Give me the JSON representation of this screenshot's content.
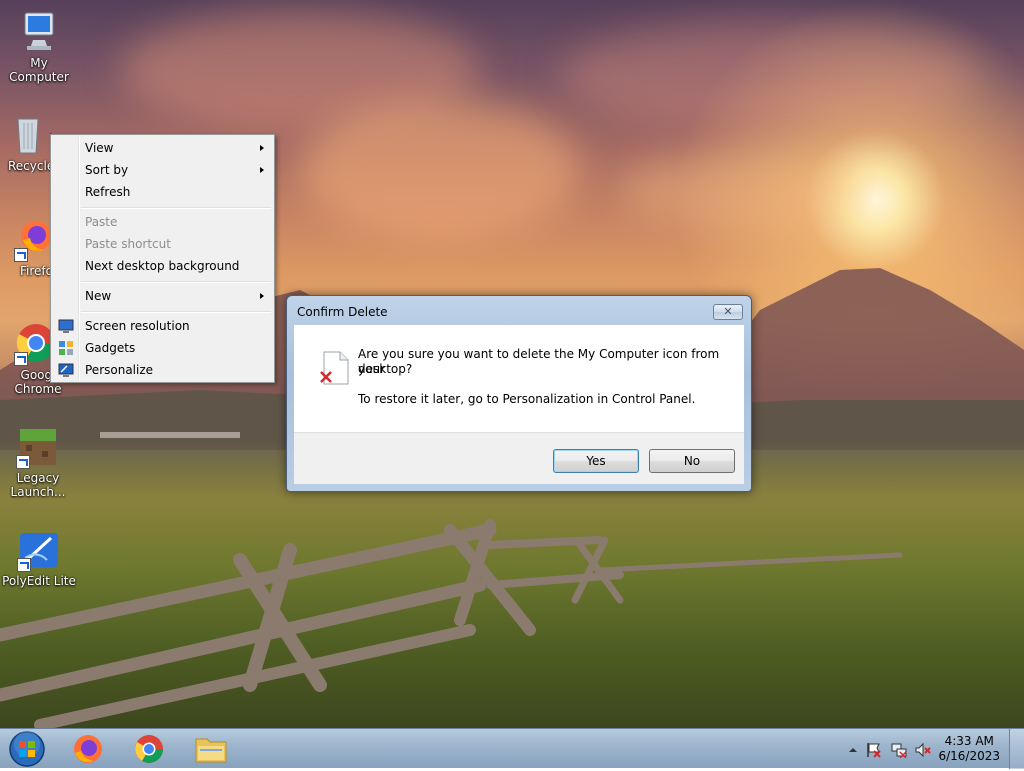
{
  "desktop_icons": [
    {
      "name": "my-computer",
      "label": "My Computer"
    },
    {
      "name": "recycle-bin",
      "label": "Recycle"
    },
    {
      "name": "firefox",
      "label": "Firefo"
    },
    {
      "name": "google-chrome",
      "label_line1": "Googl",
      "label_line2": "Chrome"
    },
    {
      "name": "legacy-launcher",
      "label_line1": "Legacy",
      "label_line2": "Launch..."
    },
    {
      "name": "polyedit-lite",
      "label": "PolyEdit Lite"
    }
  ],
  "context_menu": {
    "items": [
      {
        "label": "View",
        "submenu": true,
        "disabled": false
      },
      {
        "label": "Sort by",
        "submenu": true,
        "disabled": false
      },
      {
        "label": "Refresh",
        "submenu": false,
        "disabled": false
      },
      {
        "label": "Paste",
        "submenu": false,
        "disabled": true
      },
      {
        "label": "Paste shortcut",
        "submenu": false,
        "disabled": true
      },
      {
        "label": "Next desktop background",
        "submenu": false,
        "disabled": false
      },
      {
        "label": "New",
        "submenu": true,
        "disabled": false
      },
      {
        "label": "Screen resolution",
        "submenu": false,
        "disabled": false,
        "icon": "screen-resolution-icon"
      },
      {
        "label": "Gadgets",
        "submenu": false,
        "disabled": false,
        "icon": "gadgets-icon"
      },
      {
        "label": "Personalize",
        "submenu": false,
        "disabled": false,
        "icon": "personalize-icon"
      }
    ]
  },
  "dialog": {
    "title": "Confirm Delete",
    "close_glyph": "✕",
    "message_line1": "Are you sure you want to delete the My Computer icon from your",
    "message_line2": "desktop?",
    "message_line3": "To restore it later, go to Personalization in Control Panel.",
    "yes_label": "Yes",
    "no_label": "No"
  },
  "taskbar": {
    "apps": [
      "start-button",
      "firefox",
      "google-chrome",
      "file-explorer"
    ],
    "clock_time": "4:33 AM",
    "clock_date": "6/16/2023",
    "tray_icons": [
      "show-hidden-icons-arrow-icon",
      "action-center-flag-icon",
      "network-icon",
      "volume-muted-icon"
    ]
  },
  "colors": {
    "dialog_frame": "#a7c0dc",
    "default_button_border": "#3c7fb1",
    "menu_background": "#f0f0f0",
    "disabled_text": "#8d8d8d"
  }
}
